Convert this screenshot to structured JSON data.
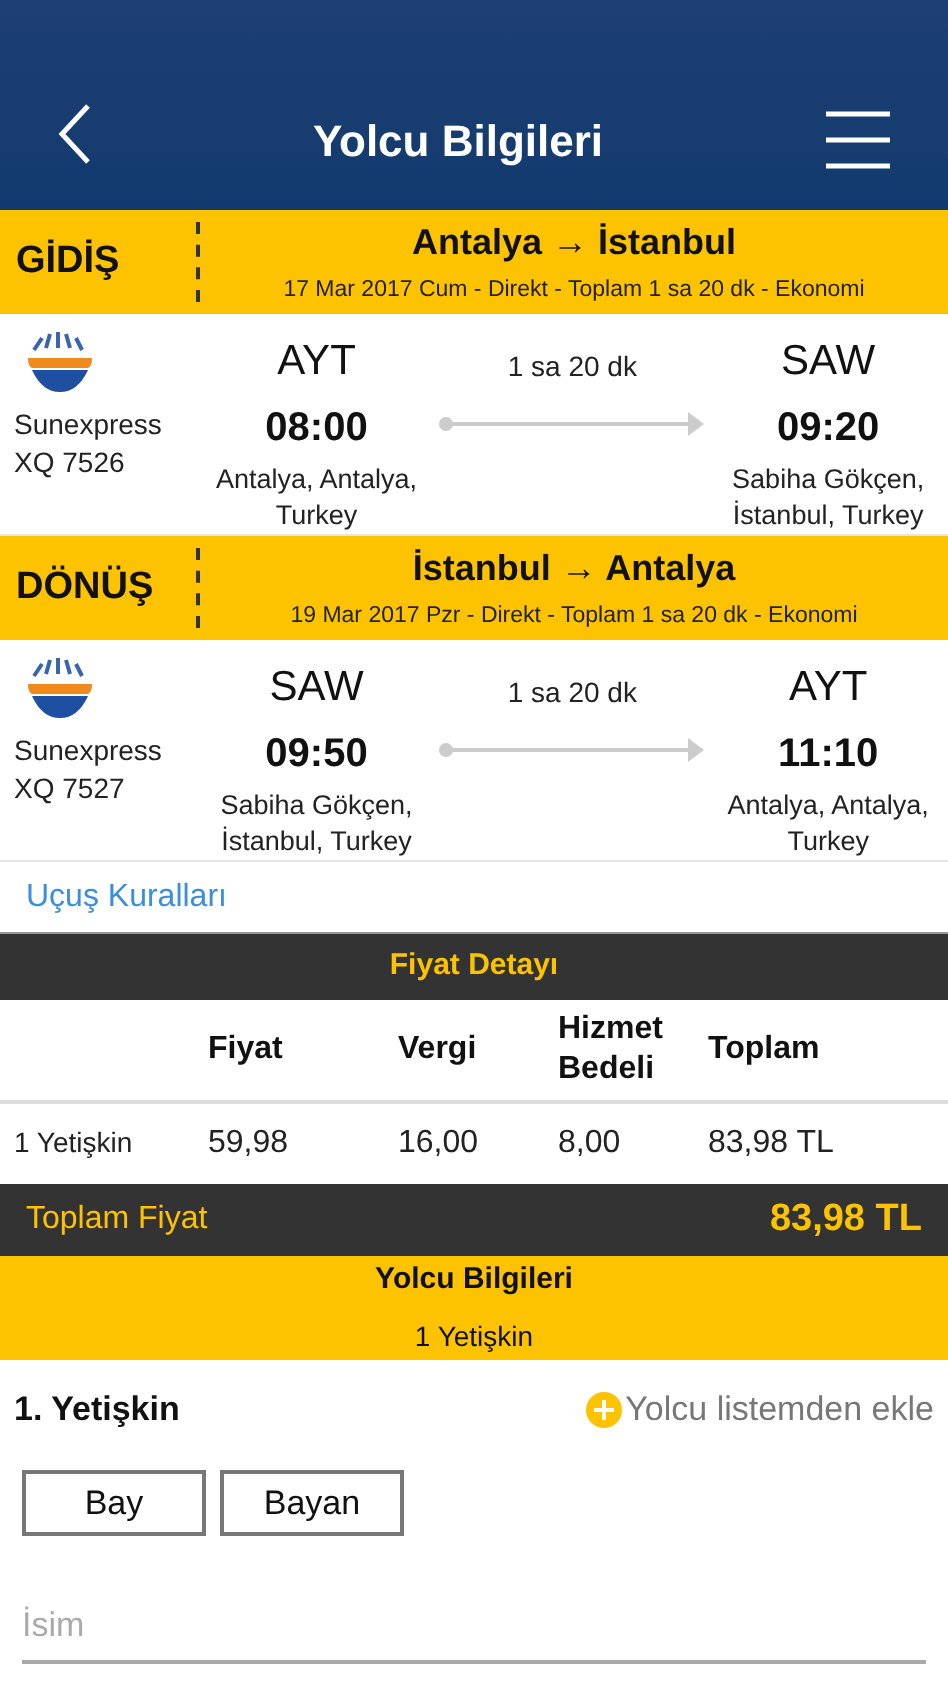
{
  "header": {
    "title": "Yolcu Bilgileri"
  },
  "legs": [
    {
      "label": "GİDİŞ",
      "route": "Antalya → İstanbul",
      "details": "17 Mar 2017 Cum - Direkt - Toplam 1 sa 20 dk - Ekonomi",
      "airline": "Sunexpress",
      "flight_no": "XQ 7526",
      "from_code": "AYT",
      "from_time": "08:00",
      "from_place": "Antalya, Antalya, Turkey",
      "duration": "1 sa 20 dk",
      "to_code": "SAW",
      "to_time": "09:20",
      "to_place": "Sabiha Gökçen, İstanbul, Turkey"
    },
    {
      "label": "DÖNÜŞ",
      "route": "İstanbul → Antalya",
      "details": "19 Mar 2017 Pzr - Direkt - Toplam 1 sa 20 dk - Ekonomi",
      "airline": "Sunexpress",
      "flight_no": "XQ 7527",
      "from_code": "SAW",
      "from_time": "09:50",
      "from_place": "Sabiha Gökçen, İstanbul, Turkey",
      "duration": "1 sa 20 dk",
      "to_code": "AYT",
      "to_time": "11:10",
      "to_place": "Antalya, Antalya, Turkey"
    }
  ],
  "rules_link": "Uçuş Kuralları",
  "price_detail": {
    "title": "Fiyat Detayı",
    "columns": [
      "",
      "Fiyat",
      "Vergi",
      "Hizmet Bedeli",
      "Toplam"
    ],
    "rows": [
      [
        "1 Yetişkin",
        "59,98",
        "16,00",
        "8,00",
        "83,98 TL"
      ]
    ],
    "total_label": "Toplam Fiyat",
    "total_value": "83,98 TL"
  },
  "passenger_info": {
    "title": "Yolcu Bilgileri",
    "subtitle": "1 Yetişkin"
  },
  "passenger": {
    "title": "1. Yetişkin",
    "add_from_list": "Yolcu listemden ekle",
    "genders": [
      {
        "label": "Bay",
        "selected": false
      },
      {
        "label": "Bayan",
        "selected": false
      }
    ],
    "name_field": {
      "placeholder": "İsim"
    }
  }
}
